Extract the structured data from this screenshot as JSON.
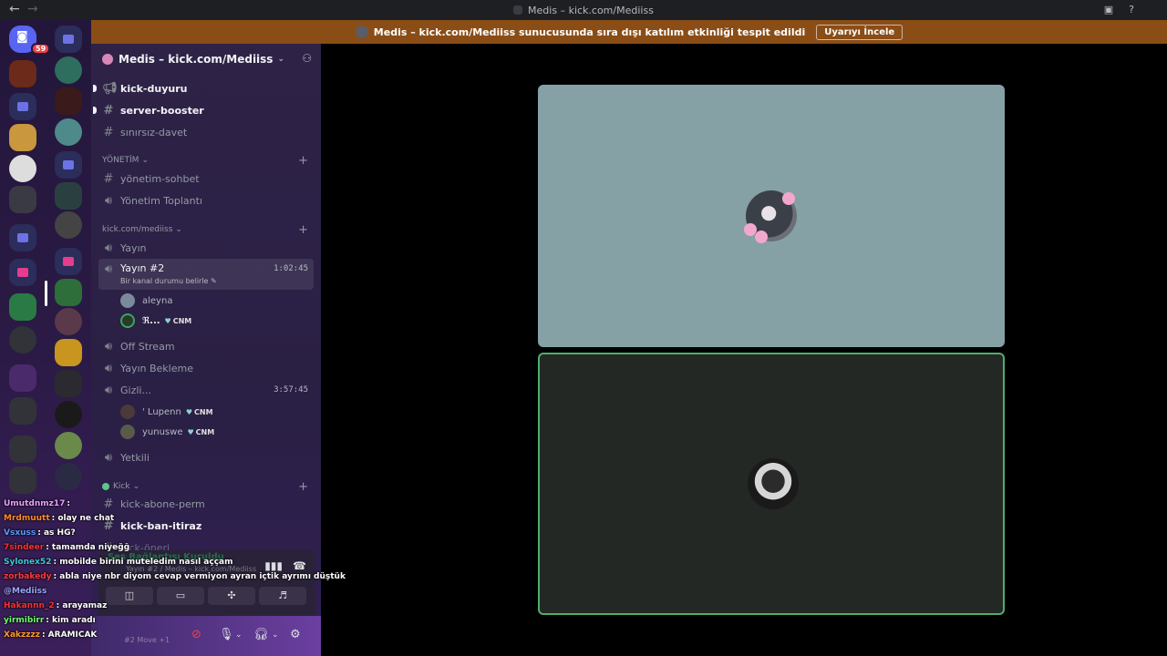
{
  "window": {
    "title": "Medis – kick.com/Mediiss"
  },
  "banner": {
    "text": "Medis – kick.com/Mediiss sunucusunda sıra dışı katılım etkinliği tespit edildi",
    "button": "Uyarıyı İncele"
  },
  "rail": {
    "dm_badge": "59"
  },
  "server": {
    "name": "Medis – kick.com/Mediiss"
  },
  "channels": {
    "top": [
      {
        "name": "kick-duyuru",
        "icon": "megaphone-icon"
      },
      {
        "name": "server-booster",
        "icon": "hash-icon"
      },
      {
        "name": "sınırsız-davet",
        "icon": "hash-icon"
      }
    ],
    "cat_yonetim": "YÖNETİM",
    "yonetim": [
      {
        "name": "yönetim-sohbet"
      },
      {
        "name": "Yönetim Toplantı"
      }
    ],
    "cat_kick": "kick.com/mediiss",
    "yayin": "Yayın",
    "yayin2": {
      "name": "Yayın #2",
      "timer": "1:02:45",
      "status": "Bir kanal durumu belirle"
    },
    "yayin2_users": [
      {
        "name": "aleyna",
        "tag": ""
      },
      {
        "name": "ℜ...",
        "tag": "CNM"
      }
    ],
    "off_stream": "Off Stream",
    "yayin_bekleme": "Yayın Bekleme",
    "gizli": {
      "name": "Gizli...",
      "timer": "3:57:45"
    },
    "gizli_users": [
      {
        "name": "' Lupenn",
        "tag": "CNM"
      },
      {
        "name": "yunuswe",
        "tag": "CNM"
      }
    ],
    "yetkili": "Yetkili",
    "cat_kick2": "Kick",
    "kick2": [
      {
        "name": "kick-abone-perm"
      },
      {
        "name": "kick-ban-itiraz"
      },
      {
        "name": "kick-öneri"
      }
    ]
  },
  "voice": {
    "title": "Ses Bağlantısı Kuruldu",
    "sub": "Yayın #2 / Medis – kick.com/Mediiss"
  },
  "userbar": {
    "sub": "#2 Move +1"
  },
  "chat": [
    {
      "name": "Umutdnmz17",
      "text": ": ",
      "color": "#e8a0ff"
    },
    {
      "name": "Mrdmuutt",
      "text": ": olay ne chat",
      "color": "#ff8a2a"
    },
    {
      "name": "Vsxuss",
      "text": ": as HG?",
      "color": "#5a9bff"
    },
    {
      "name": "7sindeer",
      "text": ": tamamda niyeğğ",
      "color": "#ff3030"
    },
    {
      "name": "Sylonex52",
      "text": ": mobilde birini muteledim nasıl aççam",
      "color": "#3ec7d8"
    },
    {
      "name": "zorbakedy",
      "text": ": abla niye nbr diyom cevap vermiyon ayran içtik ayrımı düştük",
      "color": "#ff3a3a"
    },
    {
      "name": "@Mediiss",
      "text": "",
      "color": "#9ea7ff"
    },
    {
      "name": "Hakannn_2",
      "text": ": arayamaz",
      "color": "#ff3030"
    },
    {
      "name": "yirmibirr",
      "text": ": kim aradı",
      "color": "#6bff6b"
    },
    {
      "name": "Xakzzzz",
      "text": ": ARAMICAK",
      "color": "#ff9a2a"
    }
  ]
}
